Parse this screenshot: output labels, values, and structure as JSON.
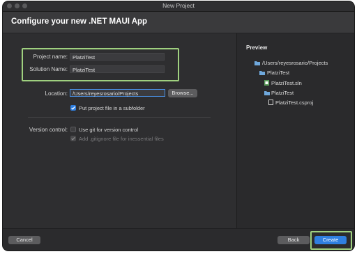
{
  "window": {
    "title": "New Project",
    "header_title": "Configure your new .NET MAUI App"
  },
  "form": {
    "project_name_label": "Project name:",
    "project_name_value": "PlatziTest",
    "solution_name_label": "Solution Name:",
    "solution_name_value": "PlatziTest",
    "location_label": "Location:",
    "location_value": "/Users/reyesrosario/Projects",
    "browse_label": "Browse...",
    "subfolder_label": "Put project file in a subfolder",
    "subfolder_checked": true,
    "version_control_label": "Version control:",
    "git_label": "Use git for version control",
    "git_checked": false,
    "gitignore_label": "Add .gitignore file for inessential files",
    "gitignore_checked": true,
    "gitignore_enabled": false
  },
  "preview": {
    "heading": "Preview",
    "tree": [
      {
        "label": "/Users/reyesrosario/Projects",
        "icon": "folder-icon"
      },
      {
        "label": "PlatziTest",
        "icon": "folder-icon"
      },
      {
        "label": "PlatziTest.sln",
        "icon": "solution-file-icon"
      },
      {
        "label": "PlatziTest",
        "icon": "folder-icon"
      },
      {
        "label": "PlatziTest.csproj",
        "icon": "project-file-icon"
      }
    ]
  },
  "footer": {
    "cancel_label": "Cancel",
    "back_label": "Back",
    "create_label": "Create"
  },
  "colors": {
    "accent": "#2f7fe0",
    "highlight": "#9fd07f",
    "folder": "#6fa8dc",
    "window_bg": "#2e2e30"
  }
}
